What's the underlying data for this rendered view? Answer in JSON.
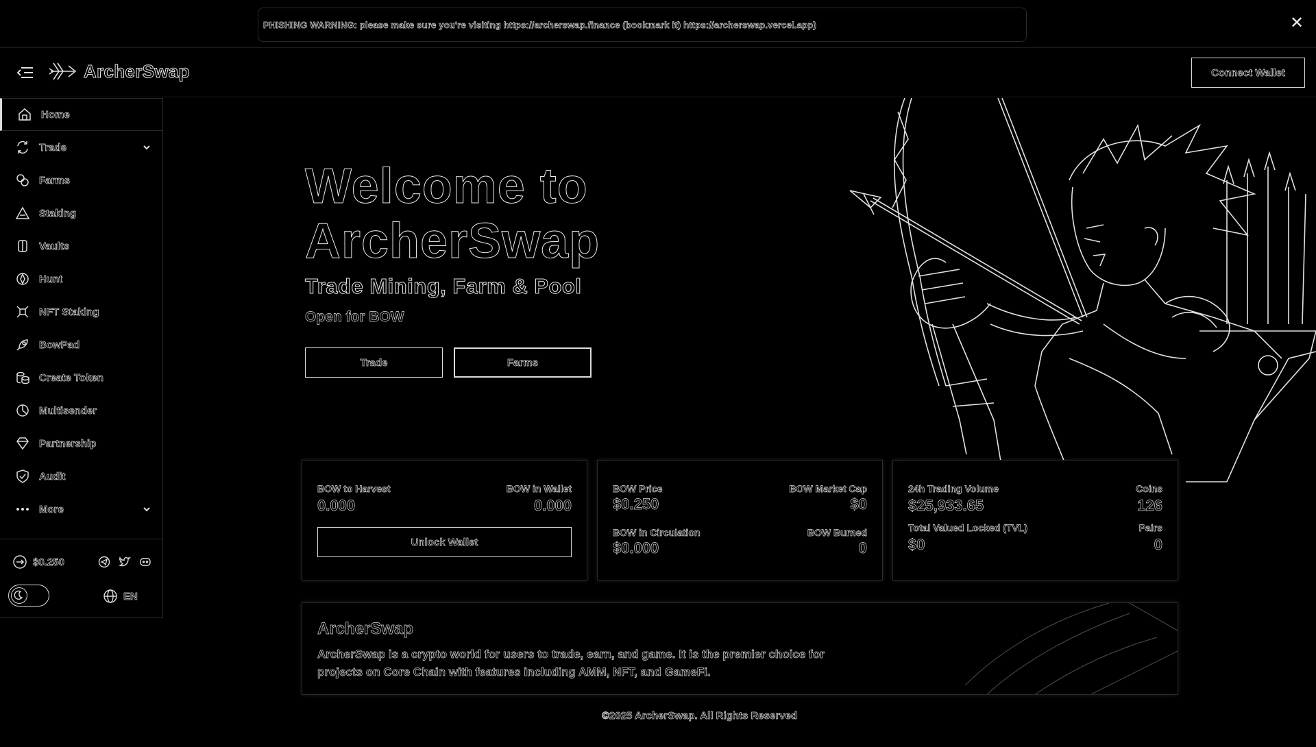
{
  "banner": {
    "text": "PHISHING WARNING: please make sure you're visiting https://archerswap.finance (bookmark it) https://archerswap.vercel.app)",
    "close_icon": "close-icon"
  },
  "header": {
    "logo_text": "ArcherSwap",
    "connect_label": "Connect Wallet"
  },
  "sidebar": {
    "items": [
      {
        "label": "Home",
        "icon": "home-icon"
      },
      {
        "label": "Trade",
        "icon": "swap-icon",
        "expandable": true
      },
      {
        "label": "Farms",
        "icon": "farm-icon"
      },
      {
        "label": "Staking",
        "icon": "staking-icon"
      },
      {
        "label": "Vaults",
        "icon": "vault-icon"
      },
      {
        "label": "Hunt",
        "icon": "hunt-icon"
      },
      {
        "label": "NFT Staking",
        "icon": "nft-staking-icon"
      },
      {
        "label": "BowPad",
        "icon": "rocket-icon"
      },
      {
        "label": "Create Token",
        "icon": "coins-icon"
      },
      {
        "label": "Multisender",
        "icon": "multisender-icon"
      },
      {
        "label": "Partnership",
        "icon": "diamond-icon"
      },
      {
        "label": "Audit",
        "icon": "shield-check-icon"
      },
      {
        "label": "More",
        "icon": "more-icon",
        "expandable": true
      }
    ],
    "price": "$0.250",
    "lang": "EN"
  },
  "hero": {
    "title_line1": "Welcome to",
    "title_line2": "ArcherSwap",
    "subtitle": "Trade Mining, Farm & Pool",
    "open_text": "Open for BOW",
    "trade_btn": "Trade",
    "farms_btn": "Farms"
  },
  "cards": {
    "harvest": {
      "k1": "BOW to Harvest",
      "v1": "0.000",
      "k2": "BOW in Wallet",
      "v2": "0.000",
      "unlock_label": "Unlock Wallet"
    },
    "price": {
      "k1": "BOW Price",
      "v1": "$0.250",
      "k2": "BOW Market Cap",
      "v2": "$0",
      "k3": "BOW in Circulation",
      "v3": "$0.000",
      "k4": "BOW Burned",
      "v4": "0"
    },
    "volume": {
      "k1": "24h Trading Volume",
      "v1": "$25,933.65",
      "k2": "Coins",
      "v2": "126",
      "k3": "Total Valued Locked (TVL)",
      "v3": "$0",
      "k4": "Pairs",
      "v4": "0"
    }
  },
  "about": {
    "title": "ArcherSwap",
    "text": "ArcherSwap is a crypto world for users to trade, earn, and game. It is the premier choice for projects on Core Chain with features including AMM, NFT, and GameFi."
  },
  "footer": {
    "text": "©2025 ArcherSwap. All Rights Reserved"
  }
}
